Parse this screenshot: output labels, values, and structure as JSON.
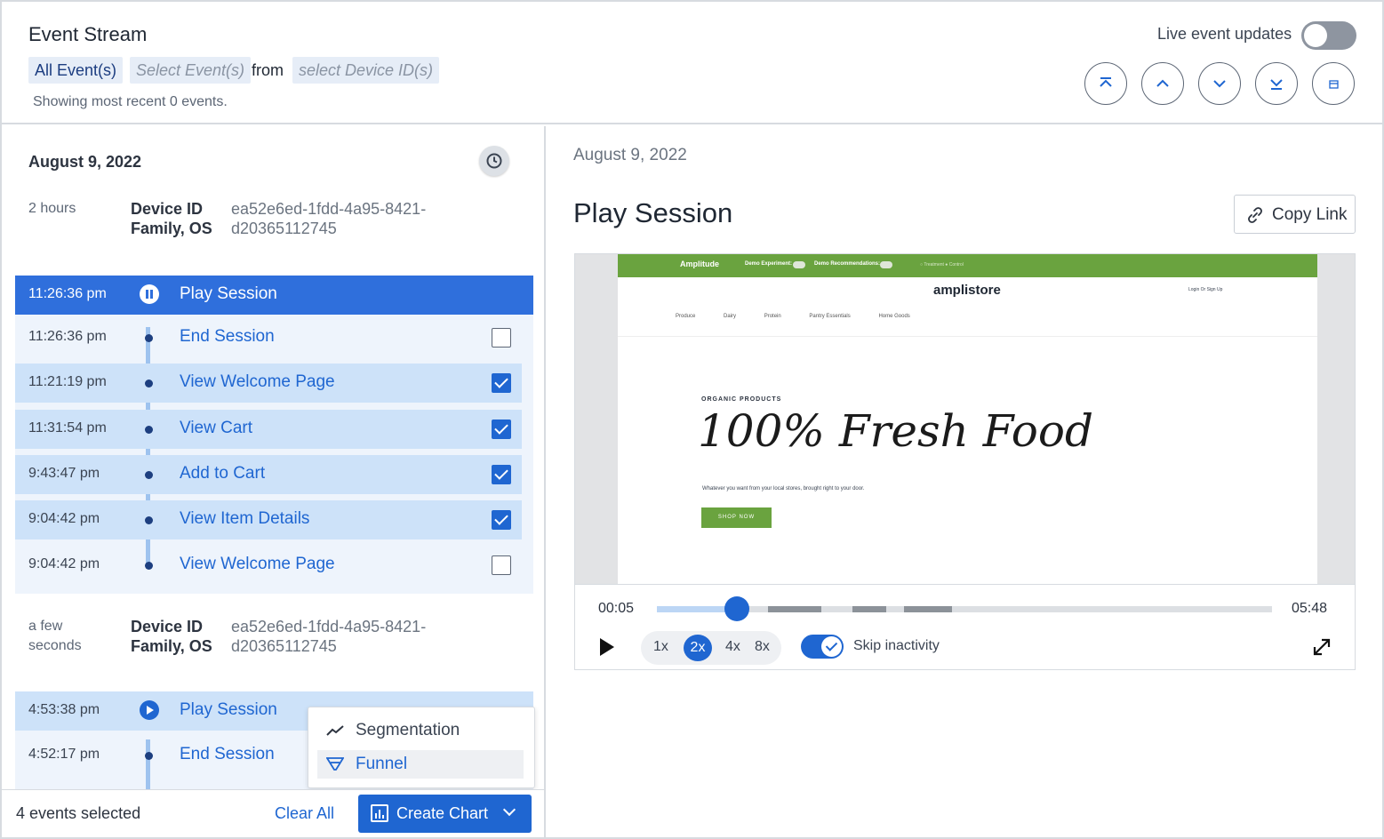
{
  "header": {
    "title": "Event Stream",
    "filter_all_events": "All Event(s)",
    "filter_select_events_placeholder": "Select Event(s)",
    "from_text": "from",
    "filter_device_placeholder": "select Device ID(s)",
    "showing_text": "Showing most recent 0 events.",
    "live_updates_label": "Live event updates",
    "live_updates_on": false,
    "nav_icons": [
      "jump-to-top-icon",
      "chevron-up-icon",
      "chevron-down-icon",
      "jump-to-bottom-icon",
      "calendar-icon"
    ]
  },
  "left": {
    "date": "August 9, 2022",
    "sessions": [
      {
        "ago": "2 hours",
        "device_label": "Device ID Family, OS",
        "device_value": "ea52e6ed-1fdd-4a95-8421-d20365112745",
        "events": [
          {
            "time": "11:26:36 pm",
            "name": "Play Session",
            "state": "playing"
          },
          {
            "time": "11:26:36 pm",
            "name": "End Session",
            "checked": false
          },
          {
            "time": "11:21:19 pm",
            "name": "View Welcome Page",
            "checked": true
          },
          {
            "time": "11:31:54 pm",
            "name": "View Cart",
            "checked": true
          },
          {
            "time": "9:43:47 pm",
            "name": "Add to Cart",
            "checked": true
          },
          {
            "time": "9:04:42 pm",
            "name": "View Item Details",
            "checked": true
          },
          {
            "time": "9:04:42 pm",
            "name": "View Welcome Page",
            "checked": false
          }
        ]
      },
      {
        "ago": "a few seconds",
        "device_label": "Device ID Family, OS",
        "device_value": "ea52e6ed-1fdd-4a95-8421-d20365112745",
        "events": [
          {
            "time": "4:53:38 pm",
            "name": "Play Session",
            "state": "paused"
          },
          {
            "time": "4:52:17 pm",
            "name": "End Session"
          }
        ]
      }
    ],
    "selected_count": "4 events selected",
    "clear_all": "Clear All",
    "create_chart": "Create Chart",
    "chart_menu": [
      "Segmentation",
      "Funnel"
    ]
  },
  "right": {
    "date": "August 9, 2022",
    "title": "Play Session",
    "copy_link": "Copy Link",
    "replay": {
      "brand": "Amplitude",
      "demo_experiment": "Demo Experiment:",
      "demo_recommendations": "Demo Recommendations:",
      "treatment": "○ Treatment  ● Control",
      "store_name": "amplistore",
      "login": "Login Or Sign Up",
      "nav": [
        "Produce",
        "Dairy",
        "Protein",
        "Pantry Essentials",
        "Home Goods"
      ],
      "eyebrow": "ORGANIC PRODUCTS",
      "hero": "100% Fresh Food",
      "subtext": "Whatever you want from your local stores, brought right to your door.",
      "cta": "SHOP NOW"
    },
    "player": {
      "current_time": "00:05",
      "end_time": "05:48",
      "progress_fraction": 0.13,
      "speeds": [
        "1x",
        "2x",
        "4x",
        "8x"
      ],
      "active_speed": "2x",
      "skip_inactivity_label": "Skip inactivity",
      "skip_inactivity_on": true
    }
  },
  "colors": {
    "accent": "#1f66d1",
    "active_row": "#2f6fdc",
    "selected_row": "#cde2f9",
    "brand_green": "#6aa33f"
  }
}
